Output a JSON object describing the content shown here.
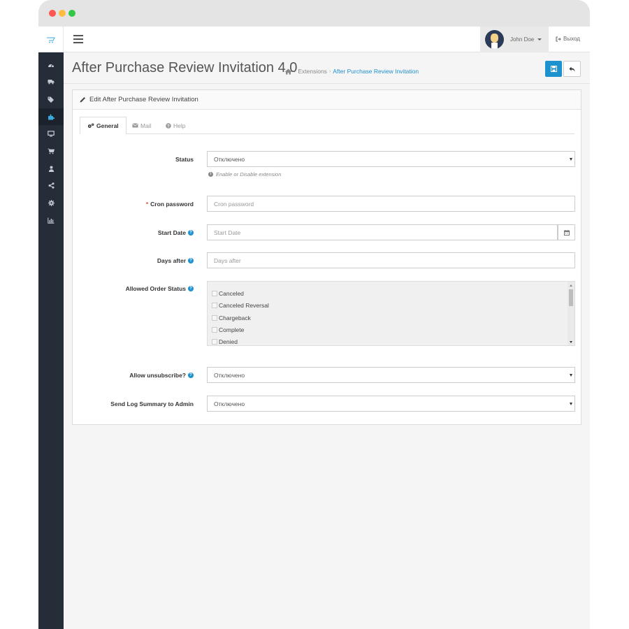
{
  "topbar": {
    "user_name": "John Doe",
    "logout_label": "Выход"
  },
  "page": {
    "title": "After Purchase Review Invitation 4.0",
    "breadcrumb": [
      "Extensions",
      "After Purchase Review Invitation"
    ]
  },
  "panel": {
    "heading": "Edit After Purchase Review Invitation",
    "tabs": [
      {
        "label": "General",
        "icon": "cogs-icon",
        "active": true
      },
      {
        "label": "Mail",
        "icon": "envelope-icon",
        "active": false
      },
      {
        "label": "Help",
        "icon": "question-circle-icon",
        "active": false
      }
    ]
  },
  "form": {
    "status": {
      "label": "Status",
      "value": "Отключено",
      "hint": "Enable or Disable extension"
    },
    "cron_password": {
      "label": "Cron password",
      "required_mark": "*",
      "placeholder": "Cron password"
    },
    "start_date": {
      "label": "Start Date",
      "placeholder": "Start Date"
    },
    "days_after": {
      "label": "Days after",
      "placeholder": "Days after"
    },
    "allowed_order_status": {
      "label": "Allowed Order Status",
      "options": [
        "Canceled",
        "Canceled Reversal",
        "Chargeback",
        "Complete",
        "Denied"
      ]
    },
    "allow_unsubscribe": {
      "label": "Allow unsubscribe?",
      "value": "Отключено"
    },
    "send_log_summary": {
      "label": "Send Log Summary to Admin",
      "value": "Отключено"
    }
  },
  "sidebar_icons": [
    "dashboard-icon",
    "catalog-truck-icon",
    "tags-icon",
    "extensions-puzzle-icon",
    "design-monitor-icon",
    "cart-icon",
    "customer-icon",
    "share-icon",
    "settings-gear-icon",
    "reports-chart-icon"
  ],
  "colors": {
    "primary": "#1e91cf",
    "sidebar": "#242d38",
    "required": "#e3503e"
  }
}
